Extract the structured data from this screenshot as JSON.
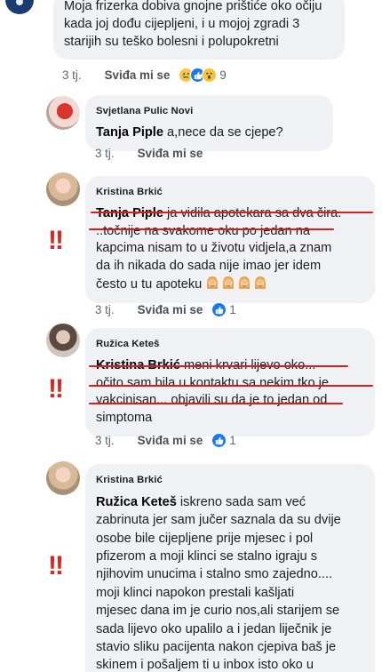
{
  "comments": [
    {
      "author": "",
      "body_lines": [
        "Moja frizerka dobiva gnojne prištiće oko očiju",
        "kada joj dođu cijepljeni, i u mojoj zgradi 3",
        "starijih su teško bolesni i polupokretni"
      ],
      "time": "3 tj.",
      "like_label": "Sviđa mi se",
      "reaction_count": "9",
      "reactions": [
        "sad-icon",
        "like-icon",
        "wow-icon"
      ]
    },
    {
      "author": "Svjetlana Pulic Novi",
      "tag": "Tanja Piple",
      "body_lines": [
        "a,nece da se cjepe?"
      ],
      "time": "3 tj.",
      "like_label": "Sviđa mi se"
    },
    {
      "author": "Kristina Brkić",
      "tag": "Tanja Piple",
      "body_lines": [
        "ja vidila apotekara sa dva čira.",
        "..točnije na svakome oku po jedan na",
        "kapcima nisam to u životu vidjela,a znam",
        "da ih nikada do sada nije imao jer idem",
        "često u tu apoteku"
      ],
      "emoji_count": 4,
      "time": "3 tj.",
      "like_label": "Sviđa mi se",
      "reaction_count": "1",
      "reactions": [
        "like-icon"
      ]
    },
    {
      "author": "Ružica Keteš",
      "tag": "Kristina Brkić",
      "body_lines": [
        "meni krvari lijevo oko...",
        "očito sam bila u kontaktu sa nekim tko je",
        "vakcinisan... objavili su da je to jedan od",
        "simptoma"
      ],
      "time": "3 tj.",
      "like_label": "Sviđa mi se",
      "reaction_count": "1",
      "reactions": [
        "like-icon"
      ]
    },
    {
      "author": "Kristina Brkić",
      "tag": "Ružica Keteš",
      "body_lines": [
        "iskreno sada sam već",
        "zabrinuta jer sam jučer saznala da su dvije",
        "osobe bile cijepljene prije mjesec i pol",
        "pfizerom a moji klinci se stalno igraju s",
        "njihovim unucima i stalno smo zajedno....",
        "moji klinci napokon prestali kašljati",
        "mjesec dana im je curio nos,ali starijem se",
        "sada lijevo oko upalilo a i jedan liječnik je",
        "stavio sliku pacijenta nakon cjepiva baš je",
        "skinem i pošaljem ti u inbox isto oko u"
      ]
    }
  ],
  "annotation": {
    "marks": "!!",
    "color": "#e1231b"
  },
  "colors": {
    "bubble": "#eff1f5",
    "meta": "#65676b",
    "like_blue": "#1877f2",
    "underline": "#d91c1c"
  }
}
